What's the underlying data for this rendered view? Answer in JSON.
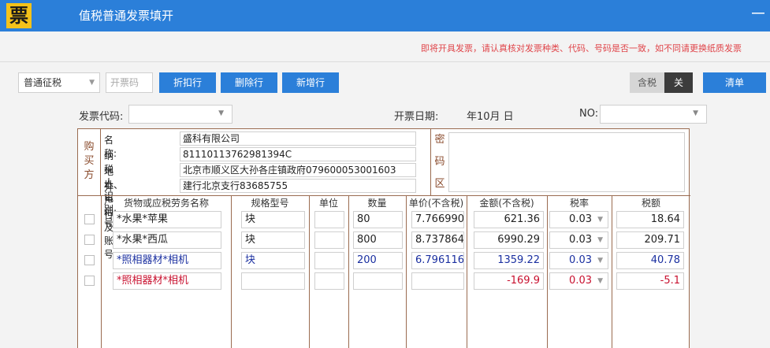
{
  "window": {
    "icon_glyph": "票",
    "title": "值税普通发票填开",
    "minimize": "－"
  },
  "warning": "即将开具发票，请认真核对发票种类、代码、号码是否一致，如不同请更换纸质发票",
  "toolbar": {
    "invoice_type": "普通征税",
    "invoice_code_placeholder": "开票码",
    "discount_button": "折扣行",
    "delete_button": "删除行",
    "add_button": "新增行",
    "tax_included_label": "含税",
    "tax_included_state": "关",
    "clear_button": "清单"
  },
  "header": {
    "code_label": "发票代码:",
    "date_label": "开票日期:",
    "date_value": "年10月    日",
    "no_label": "NO:"
  },
  "buyer": {
    "tag": "购买方",
    "name_label": "名        称:",
    "name": "盛科有限公司",
    "taxid_label": "纳税人识别号:",
    "taxid": "81110113762981394C",
    "address_label": "地址、  电话:",
    "address": "北京市顺义区大孙各庄镇政府079600053001603",
    "bank_label": "开户行及账号:",
    "bank": "建行北京支行83685755",
    "secret_chars": [
      "密",
      "码",
      "区"
    ]
  },
  "items": {
    "headers": {
      "name": "货物或应税劳务名称",
      "spec": "规格型号",
      "unit": "单位",
      "qty": "数量",
      "price": "单价(不含税)",
      "amount": "金额(不含税)",
      "rate": "税率",
      "tax": "税额"
    },
    "rows": [
      {
        "name": "*水果*苹果",
        "spec": "块",
        "unit": "",
        "qty": "80",
        "price": "7.766990",
        "amount": "621.36",
        "rate": "0.03",
        "tax": "18.64",
        "color": "#222222"
      },
      {
        "name": "*水果*西瓜",
        "spec": "块",
        "unit": "",
        "qty": "800",
        "price": "8.737864",
        "amount": "6990.29",
        "rate": "0.03",
        "tax": "209.71",
        "color": "#222222"
      },
      {
        "name": "*照相器材*相机",
        "spec": "块",
        "unit": "",
        "qty": "200",
        "price": "6.796116",
        "amount": "1359.22",
        "rate": "0.03",
        "tax": "40.78",
        "color": "#1a2fa0"
      },
      {
        "name": "*照相器材*相机",
        "spec": "",
        "unit": "",
        "qty": "",
        "price": "",
        "amount": "-169.9",
        "rate": "0.03",
        "tax": "-5.1",
        "color": "#c8102e"
      }
    ]
  },
  "colors": {
    "titlebar": "#2b7fd9",
    "button": "#2b7fd9",
    "grid_line": "#9a6b50",
    "warning": "#e0454a",
    "discount_row": "#c8102e",
    "highlight_row": "#1a2fa0"
  }
}
